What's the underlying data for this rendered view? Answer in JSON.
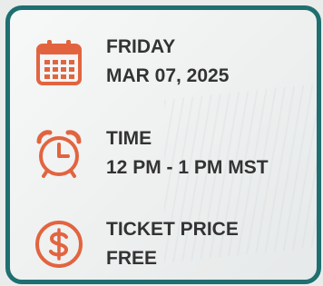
{
  "colors": {
    "accent": "#e2643f",
    "border": "#1f6f70",
    "text": "#333333"
  },
  "date": {
    "icon": "calendar-icon",
    "line1": "FRIDAY",
    "line2": "MAR 07, 2025"
  },
  "time": {
    "icon": "alarm-clock-icon",
    "line1": "TIME",
    "line2": "12 PM - 1 PM MST"
  },
  "price": {
    "icon": "dollar-coin-icon",
    "line1": "TICKET PRICE",
    "line2": "FREE"
  }
}
